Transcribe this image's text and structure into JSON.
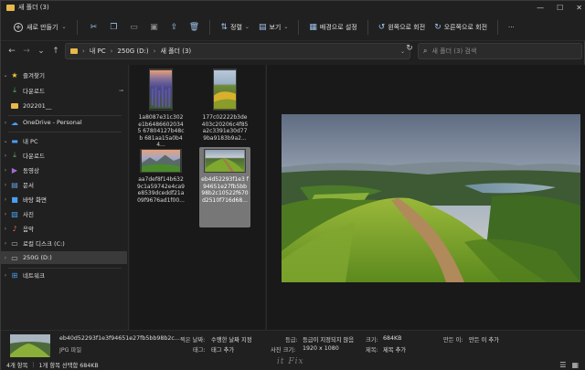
{
  "window": {
    "title": "새 폴더 (3)",
    "controls": {
      "minimize": "—",
      "maximize": "☐",
      "close": "✕"
    }
  },
  "toolbar": {
    "new_label": "새로 만들기",
    "icons": [
      "cut-icon",
      "copy-icon",
      "rename-icon",
      "paste-icon",
      "share-icon",
      "delete-icon"
    ],
    "sort_label": "정렬",
    "view_label": "보기",
    "set_wallpaper_label": "배경으로 설정",
    "rotate_left_label": "왼쪽으로 회전",
    "rotate_right_label": "오른쪽으로 회전",
    "more_label": "···"
  },
  "address": {
    "segments": [
      "내 PC",
      "250G (D:)",
      "새 폴더 (3)"
    ],
    "search_placeholder": "새 폴더 (3) 검색"
  },
  "sidebar": {
    "items": [
      {
        "label": "즐겨찾기",
        "icon": "star-icon",
        "color": "#f2c53d"
      },
      {
        "label": "다운로드",
        "icon": "download-icon",
        "color": "#58b86c",
        "pinned": true
      },
      {
        "label": "202201__",
        "icon": "folder-icon",
        "color": "#e8b84a"
      },
      {
        "label": "OneDrive - Personal",
        "icon": "cloud-icon",
        "color": "#4aa0f0"
      },
      {
        "label": "내 PC",
        "icon": "pc-icon",
        "color": "#4aa0f0"
      },
      {
        "label": "다운로드",
        "icon": "download-icon",
        "color": "#58b86c"
      },
      {
        "label": "동영상",
        "icon": "video-icon",
        "color": "#a46bd6"
      },
      {
        "label": "문서",
        "icon": "document-icon",
        "color": "#6a9fd8"
      },
      {
        "label": "바탕 화면",
        "icon": "desktop-icon",
        "color": "#4aa0f0"
      },
      {
        "label": "사진",
        "icon": "pictures-icon",
        "color": "#4aa0f0"
      },
      {
        "label": "음악",
        "icon": "music-icon",
        "color": "#e86a5a"
      },
      {
        "label": "로컬 디스크 (C:)",
        "icon": "drive-icon",
        "color": "#bcbcbc"
      },
      {
        "label": "250G (D:)",
        "icon": "drive-icon",
        "color": "#bcbcbc"
      },
      {
        "label": "네트워크",
        "icon": "network-icon",
        "color": "#4aa0f0"
      }
    ],
    "pin_glyph": "📌"
  },
  "files": [
    {
      "name": "1a8087e31c302e1b64866020345 67804127b48cb 681aa15a0b44...",
      "thumb": "lavender"
    },
    {
      "name": "177c02222b3de 403c20206c4f85 a2c3391e30d77 9ba9183b9a2...",
      "thumb": "yellowfield"
    },
    {
      "name": "aa7def8f14b632 9c1a59742e4ca9 e8539dceddf21a 09f9676ad1f00...",
      "thumb": "alpine"
    },
    {
      "name": "eb4d52293f1e3 f94651e27fb5bb 98b2c10522f670 d2510f716d68...",
      "thumb": "ridge",
      "selected": true
    }
  ],
  "details": {
    "file_name": "eb40d52293f1e3f94651e27fb5bb98b2c...",
    "file_type": "JPG 파일",
    "date_taken_label": "찍은 날짜:",
    "date_taken_value": "수행한 날짜 지정",
    "tags_label": "태그:",
    "tags_value": "태그 추가",
    "rating_label": "등급:",
    "rating_value": "등급이 지정되지 않음",
    "dimensions_label": "사진 크기:",
    "dimensions_value": "1920 x 1080",
    "size_label": "크기:",
    "size_value": "684KB",
    "title_label": "제목:",
    "title_value": "제목 추가",
    "author_label": "만든 이:",
    "author_value": "만든 이 추가"
  },
  "status": {
    "items_count": "4개 항목",
    "selection": "1개 항목 선택함 684KB"
  },
  "watermark": "it Fix"
}
